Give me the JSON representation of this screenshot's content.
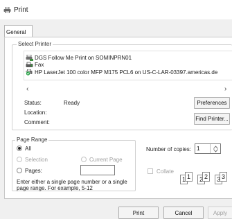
{
  "window": {
    "title": "Print",
    "icon": "printer-icon"
  },
  "tabs": [
    {
      "label": "General",
      "selected": true
    }
  ],
  "select_printer": {
    "legend": "Select Printer",
    "printers": [
      {
        "name": "DGS Follow Me Print on SOMINPRN01",
        "icon": "network-printer-icon",
        "selected": false
      },
      {
        "name": "Fax",
        "icon": "fax-icon",
        "selected": false
      },
      {
        "name": "HP LaserJet 100 color MFP M175 PCL6 on US-C-LAR-03397.americas.de",
        "icon": "default-printer-icon",
        "selected": true
      }
    ],
    "scroll_left": "‹",
    "scroll_right": "›",
    "status_label": "Status:",
    "status_value": "Ready",
    "location_label": "Location:",
    "location_value": "",
    "comment_label": "Comment:",
    "comment_value": "",
    "preferences_button": "Preferences",
    "find_printer_button": "Find Printer..."
  },
  "page_range": {
    "legend": "Page Range",
    "all_label": "All",
    "selection_label": "Selection",
    "current_page_label": "Current Page",
    "pages_label": "Pages:",
    "pages_value": "",
    "hint": "Enter either a single page number or a single page range.  For example, 5-12",
    "selected_option": "All"
  },
  "copies": {
    "label": "Number of copies:",
    "value": "1",
    "collate_label": "Collate",
    "collate_checked": false,
    "collate_pages": [
      "1",
      "1",
      "2",
      "2",
      "3",
      "3"
    ]
  },
  "footer": {
    "print_button": "Print",
    "cancel_button": "Cancel",
    "apply_button": "Apply"
  }
}
